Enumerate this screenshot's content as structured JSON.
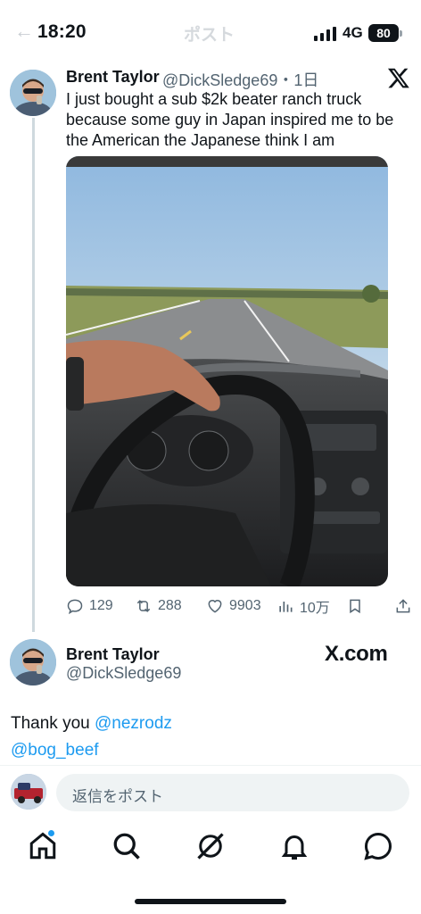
{
  "status_bar": {
    "time": "18:20",
    "network": "4G",
    "battery": "80"
  },
  "header": {
    "back_icon": "back-arrow-icon",
    "title": "ポスト"
  },
  "tweet": {
    "author_name": "Brent Taylor",
    "author_handle_time": "@DickSledge69・1日",
    "text": "I just bought a sub $2k beater ranch truck\nbecause some guy in Japan inspired me to be\nthe American the Japanese think I am",
    "actions": {
      "replies": "129",
      "reposts": "288",
      "likes": "9903",
      "views": "10万"
    }
  },
  "reply_tweet": {
    "author_name": "Brent Taylor",
    "author_handle": "@DickSledge69",
    "source_label": "X.com",
    "text_prefix": "Thank you ",
    "mention_1": "@nezrodz",
    "mention_2": "@bog_beef"
  },
  "compose": {
    "placeholder": "返信をポスト"
  },
  "bottom_nav": {
    "items": [
      "home-icon",
      "search-icon",
      "grok-icon",
      "notifications-icon",
      "messages-icon"
    ]
  },
  "colors": {
    "accent": "#1d9bf0",
    "text": "#0f1419",
    "secondary": "#536471"
  }
}
